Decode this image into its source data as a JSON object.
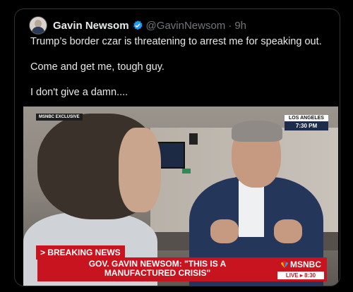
{
  "tweet": {
    "author_name": "Gavin Newsom",
    "handle": "@GavinNewsom",
    "separator": "·",
    "time": "9h",
    "lines": [
      "Trump’s border czar is threatening to arrest me for speaking out.",
      "Come and get me, tough guy.",
      "I don't give a damn...."
    ]
  },
  "media": {
    "exclusive_tag": "MSNBC EXCLUSIVE",
    "location": "LOS ANGELES",
    "local_time": "7:30 PM",
    "breaking_label": "> BREAKING NEWS",
    "headline_line1": "GOV. GAVIN NEWSOM: \"THIS IS A",
    "headline_line2": "MANUFACTURED CRISIS\"",
    "network": "MSNBC",
    "live_label": "LIVE ▸ 8:30"
  },
  "colors": {
    "verified": "#1d9bf0",
    "breaking_red": "#c8141f",
    "text": "#e7e9ea",
    "muted": "#71767b"
  },
  "icons": {
    "verified": "verified-badge-icon",
    "network_logo": "peacock-icon"
  }
}
